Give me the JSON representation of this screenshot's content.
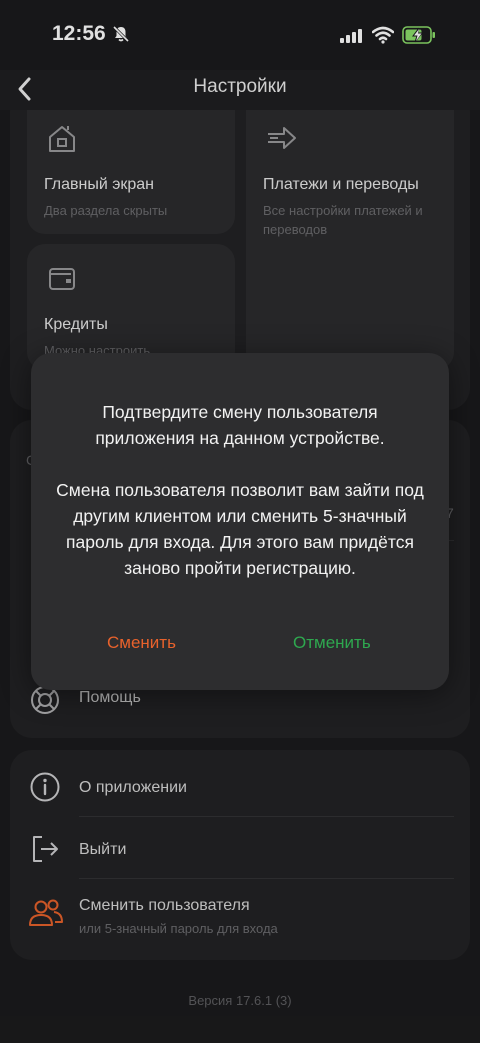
{
  "status_bar": {
    "time": "12:56"
  },
  "nav": {
    "title": "Настройки"
  },
  "tiles": [
    {
      "title": "Главный экран",
      "subtitle": "Два раздела скрыты"
    },
    {
      "title": "Платежи и переводы",
      "subtitle": "Все настройки платежей и переводов"
    },
    {
      "title": "Кредиты",
      "subtitle": "Можно настроить"
    }
  ],
  "middle": {
    "frag_left": "С",
    "frag_right": "7"
  },
  "help": {
    "label": "Помощь"
  },
  "menu": {
    "about": "О приложении",
    "exit": "Выйти",
    "switch_user": "Сменить пользователя",
    "switch_user_sub": "или 5-значный пароль для входа"
  },
  "version": "Версия 17.6.1 (3)",
  "dialog": {
    "message_1": "Подтвердите смену пользователя приложения на данном устройстве.",
    "message_2": "Смена пользователя позволит вам зайти под другим клиентом или сменить 5-значный пароль для входа. Для этого вам придётся заново пройти регистрацию.",
    "confirm": "Сменить",
    "cancel": "Отменить"
  },
  "colors": {
    "accent_orange": "#e8622c",
    "accent_green": "#2ea84f",
    "background": "#1b1b1d",
    "card": "#232325"
  }
}
